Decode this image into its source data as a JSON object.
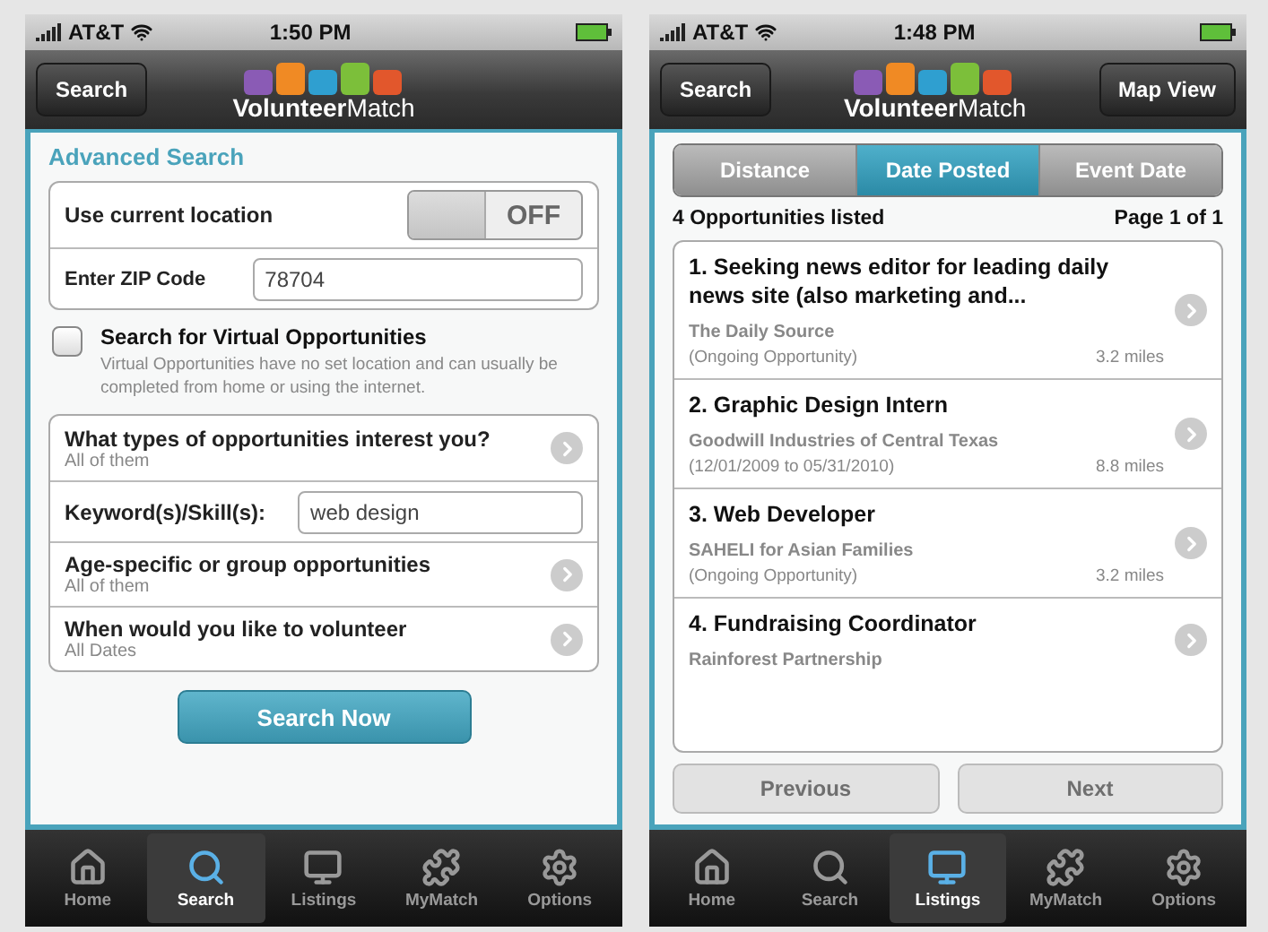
{
  "screens": [
    {
      "kind": "search",
      "status_bar": {
        "carrier": "AT&T",
        "time": "1:50 PM"
      },
      "nav_bar": {
        "back_button": "Search",
        "logo": "**Volunteer**Match"
      },
      "heading": "Advanced Search",
      "location_group": {
        "toggle": {
          "label": "Use current location",
          "on": false,
          "state_text": "OFF"
        },
        "zip": {
          "label": "Enter ZIP Code",
          "value": "78704"
        }
      },
      "virtual": {
        "label": "Search for Virtual Opportunities",
        "checked": false,
        "description": "Virtual Opportunities have no set location and can usually be completed from home or using the internet."
      },
      "options": [
        {
          "kind": "disclosure",
          "label": "What types of opportunities interest you?",
          "value": "All of them"
        },
        {
          "kind": "input",
          "label": "Keyword(s)/Skill(s):",
          "value": "web design"
        },
        {
          "kind": "disclosure",
          "label": "Age-specific or group opportunities",
          "value": "All of them"
        },
        {
          "kind": "disclosure",
          "label": "When would you like to volunteer",
          "value": "All Dates"
        }
      ],
      "submit_button": "Search Now",
      "tab_bar": [
        {
          "label": "Home",
          "selected": false
        },
        {
          "label": "Search",
          "selected": true
        },
        {
          "label": "Listings",
          "selected": false
        },
        {
          "label": "MyMatch",
          "selected": false
        },
        {
          "label": "Options",
          "selected": false
        }
      ]
    },
    {
      "kind": "listings",
      "status_bar": {
        "carrier": "AT&T",
        "time": "1:48 PM"
      },
      "nav_bar": {
        "back_button": "Search",
        "logo": "**Volunteer**Match",
        "right_button": "Map View"
      },
      "sort_segments": [
        {
          "label": "Distance",
          "selected": false
        },
        {
          "label": "Date Posted",
          "selected": true
        },
        {
          "label": "Event Date",
          "selected": false
        }
      ],
      "summary": {
        "count": "4 Opportunities listed",
        "page": "Page 1 of 1"
      },
      "items": [
        {
          "title": "1. Seeking news editor for leading daily news site (also marketing and...",
          "organization": "The Daily Source",
          "dates": "(Ongoing Opportunity)",
          "distance": "3.2 miles"
        },
        {
          "title": "2. Graphic Design Intern",
          "organization": "Goodwill Industries of Central Texas",
          "dates": "(12/01/2009 to 05/31/2010)",
          "distance": "8.8 miles"
        },
        {
          "title": "3. Web Developer",
          "organization": "SAHELI for Asian Families",
          "dates": "(Ongoing Opportunity)",
          "distance": "3.2 miles"
        },
        {
          "title": "4. Fundraising Coordinator",
          "organization": "Rainforest Partnership"
        }
      ],
      "pager": [
        {
          "label": "Previous",
          "disabled": true
        },
        {
          "label": "Next",
          "disabled": true
        }
      ],
      "tab_bar": [
        {
          "label": "Home",
          "selected": false
        },
        {
          "label": "Search",
          "selected": false
        },
        {
          "label": "Listings",
          "selected": true
        },
        {
          "label": "MyMatch",
          "selected": false
        },
        {
          "label": "Options",
          "selected": false
        }
      ]
    }
  ]
}
